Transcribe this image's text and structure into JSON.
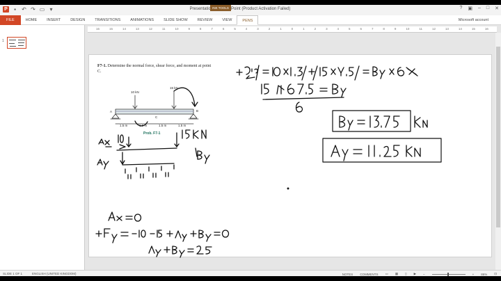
{
  "window": {
    "title": "Presentation1 - PowerPoint (Product Activation Failed)",
    "context_tab": "INK TOOLS",
    "account": "Microsoft account"
  },
  "tabs": [
    "FILE",
    "HOME",
    "INSERT",
    "DESIGN",
    "TRANSITIONS",
    "ANIMATIONS",
    "SLIDE SHOW",
    "REVIEW",
    "VIEW",
    "PENS"
  ],
  "ruler": [
    "16",
    "15",
    "14",
    "13",
    "12",
    "11",
    "10",
    "9",
    "8",
    "7",
    "6",
    "5",
    "4",
    "3",
    "2",
    "1",
    "0",
    "1",
    "2",
    "3",
    "4",
    "5",
    "6",
    "7",
    "8",
    "9",
    "10",
    "11",
    "12",
    "13",
    "14",
    "15",
    "16"
  ],
  "thumbnails": {
    "slide_number": "1"
  },
  "slide": {
    "problem_number": "F7-1.",
    "problem_text": "Determine the normal force, shear force, and moment at point C.",
    "figure": {
      "load_left": "10 kN",
      "load_right": "15 kN",
      "point_a": "A",
      "point_b": "B",
      "point_c": "C",
      "dims": [
        "1.5 m",
        "1.5 m",
        "1.5 m",
        "1.5 m"
      ],
      "caption": "Prob. F7-1"
    }
  },
  "status": {
    "slide": "SLIDE 1 OF 1",
    "language": "ENGLISH (UNITED KINGDOM)",
    "notes": "NOTES",
    "comments": "COMMENTS",
    "zoom": "86%"
  },
  "colors": {
    "accent": "#d24726",
    "ink_tools": "#8a5d2a"
  }
}
